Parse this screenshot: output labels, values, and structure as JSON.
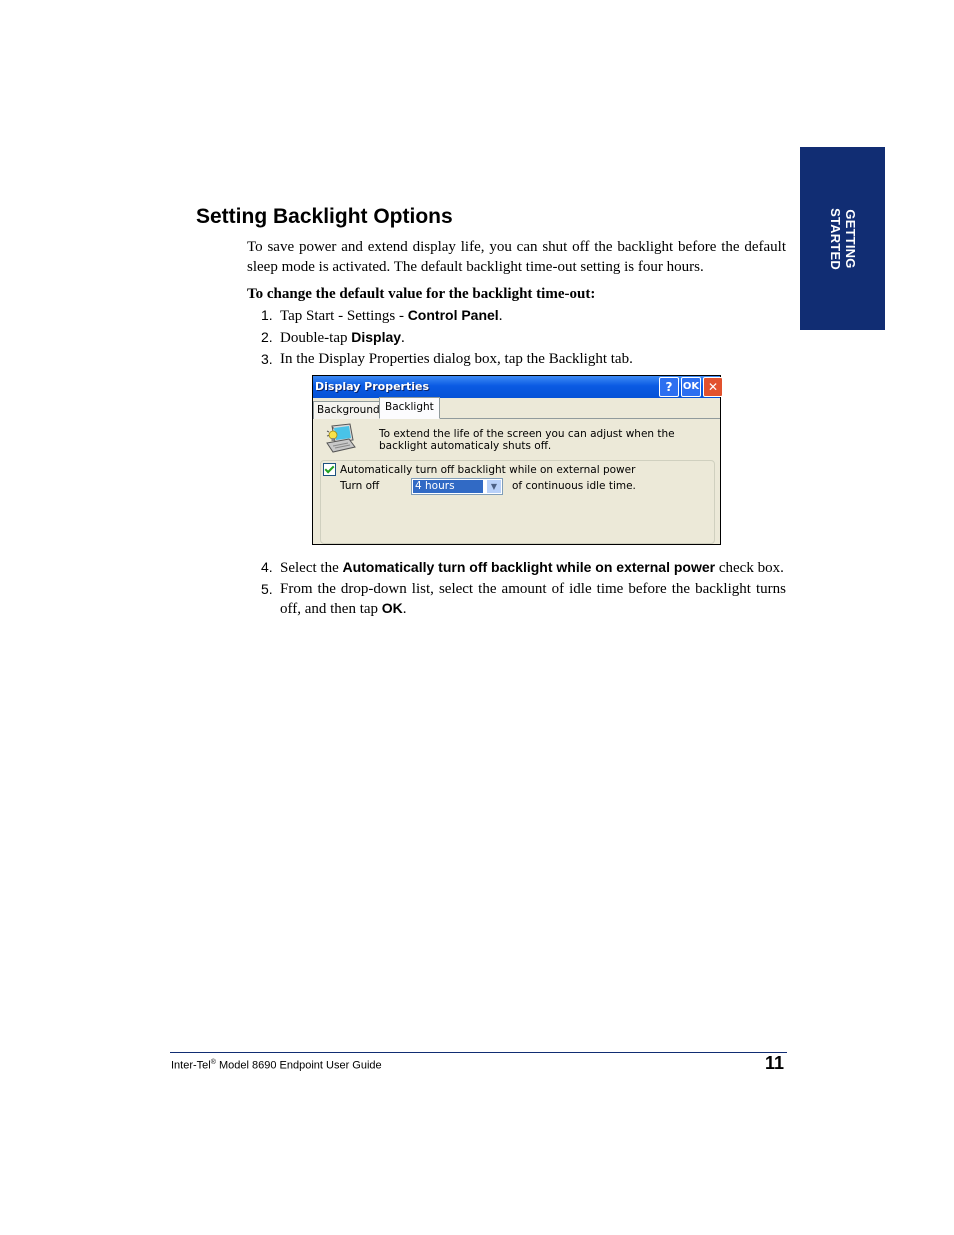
{
  "side_tab": {
    "line1": "GETTING",
    "line2": "STARTED",
    "color": "#112d73"
  },
  "heading": "Setting Backlight Options",
  "intro": "To save power and extend display life, you can shut off the backlight before the default sleep mode is activated. The default backlight time-out setting is four hours.",
  "procedure_title": "To change the default value for the backlight time-out:",
  "steps": [
    {
      "num": "1.",
      "text": "Tap Start - Settings - ",
      "bold": "Control Panel",
      "after": "."
    },
    {
      "num": "2.",
      "text": "Double-tap ",
      "bold": "Display",
      "after": "."
    },
    {
      "num": "3.",
      "text": "In the Display Properties dialog box, tap the Backlight tab.",
      "bold": "",
      "after": ""
    },
    {
      "num": "4.",
      "text": "Select the ",
      "bold": "Automatically turn off backlight while on external power",
      "after": " check box."
    },
    {
      "num": "5.",
      "text": "From the drop-down list, select the amount of idle time before the backlight turns off, and then tap ",
      "bold": "OK",
      "after": "."
    }
  ],
  "dialog": {
    "title": "Display Properties",
    "help_label": "?",
    "ok_label": "OK",
    "close_label": "✕",
    "tabs": [
      "Background",
      "Backlight"
    ],
    "active_tab": "Backlight",
    "description": "To extend the life of the screen you can adjust when the backlight automaticaly shuts off.",
    "checkbox_label": "Automatically turn off backlight while on external power",
    "checkbox_checked": true,
    "turn_off_label": "Turn off",
    "dropdown_value": "4 hours",
    "idle_label": "of continuous idle time."
  },
  "footer": {
    "brand": "Inter-Tel",
    "reg_mark": "®",
    "guide_title": " Model 8690 Endpoint User Guide",
    "page_number": "11"
  }
}
